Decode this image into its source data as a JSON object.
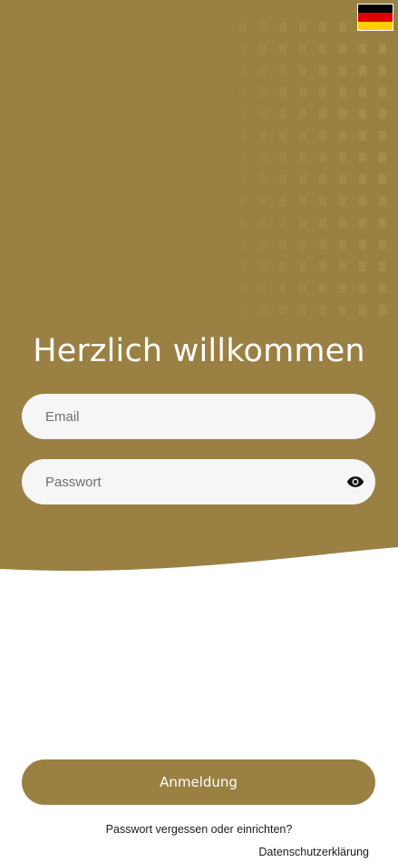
{
  "colors": {
    "brand_gold": "#9a8043",
    "input_bg": "#f6f6f6",
    "text_white": "#ffffff",
    "text_dark": "#1a1a1a"
  },
  "language": {
    "flag_icon": "flag-germany-icon"
  },
  "header": {
    "title": "Herzlich willkommen"
  },
  "form": {
    "email": {
      "placeholder": "Email",
      "value": ""
    },
    "password": {
      "placeholder": "Passwort",
      "value": "",
      "toggle_icon": "eye-icon"
    }
  },
  "actions": {
    "login_label": "Anmeldung",
    "forgot_label": "Passwort vergessen oder einrichten?",
    "privacy_label": "Datenschutzerklärung"
  }
}
